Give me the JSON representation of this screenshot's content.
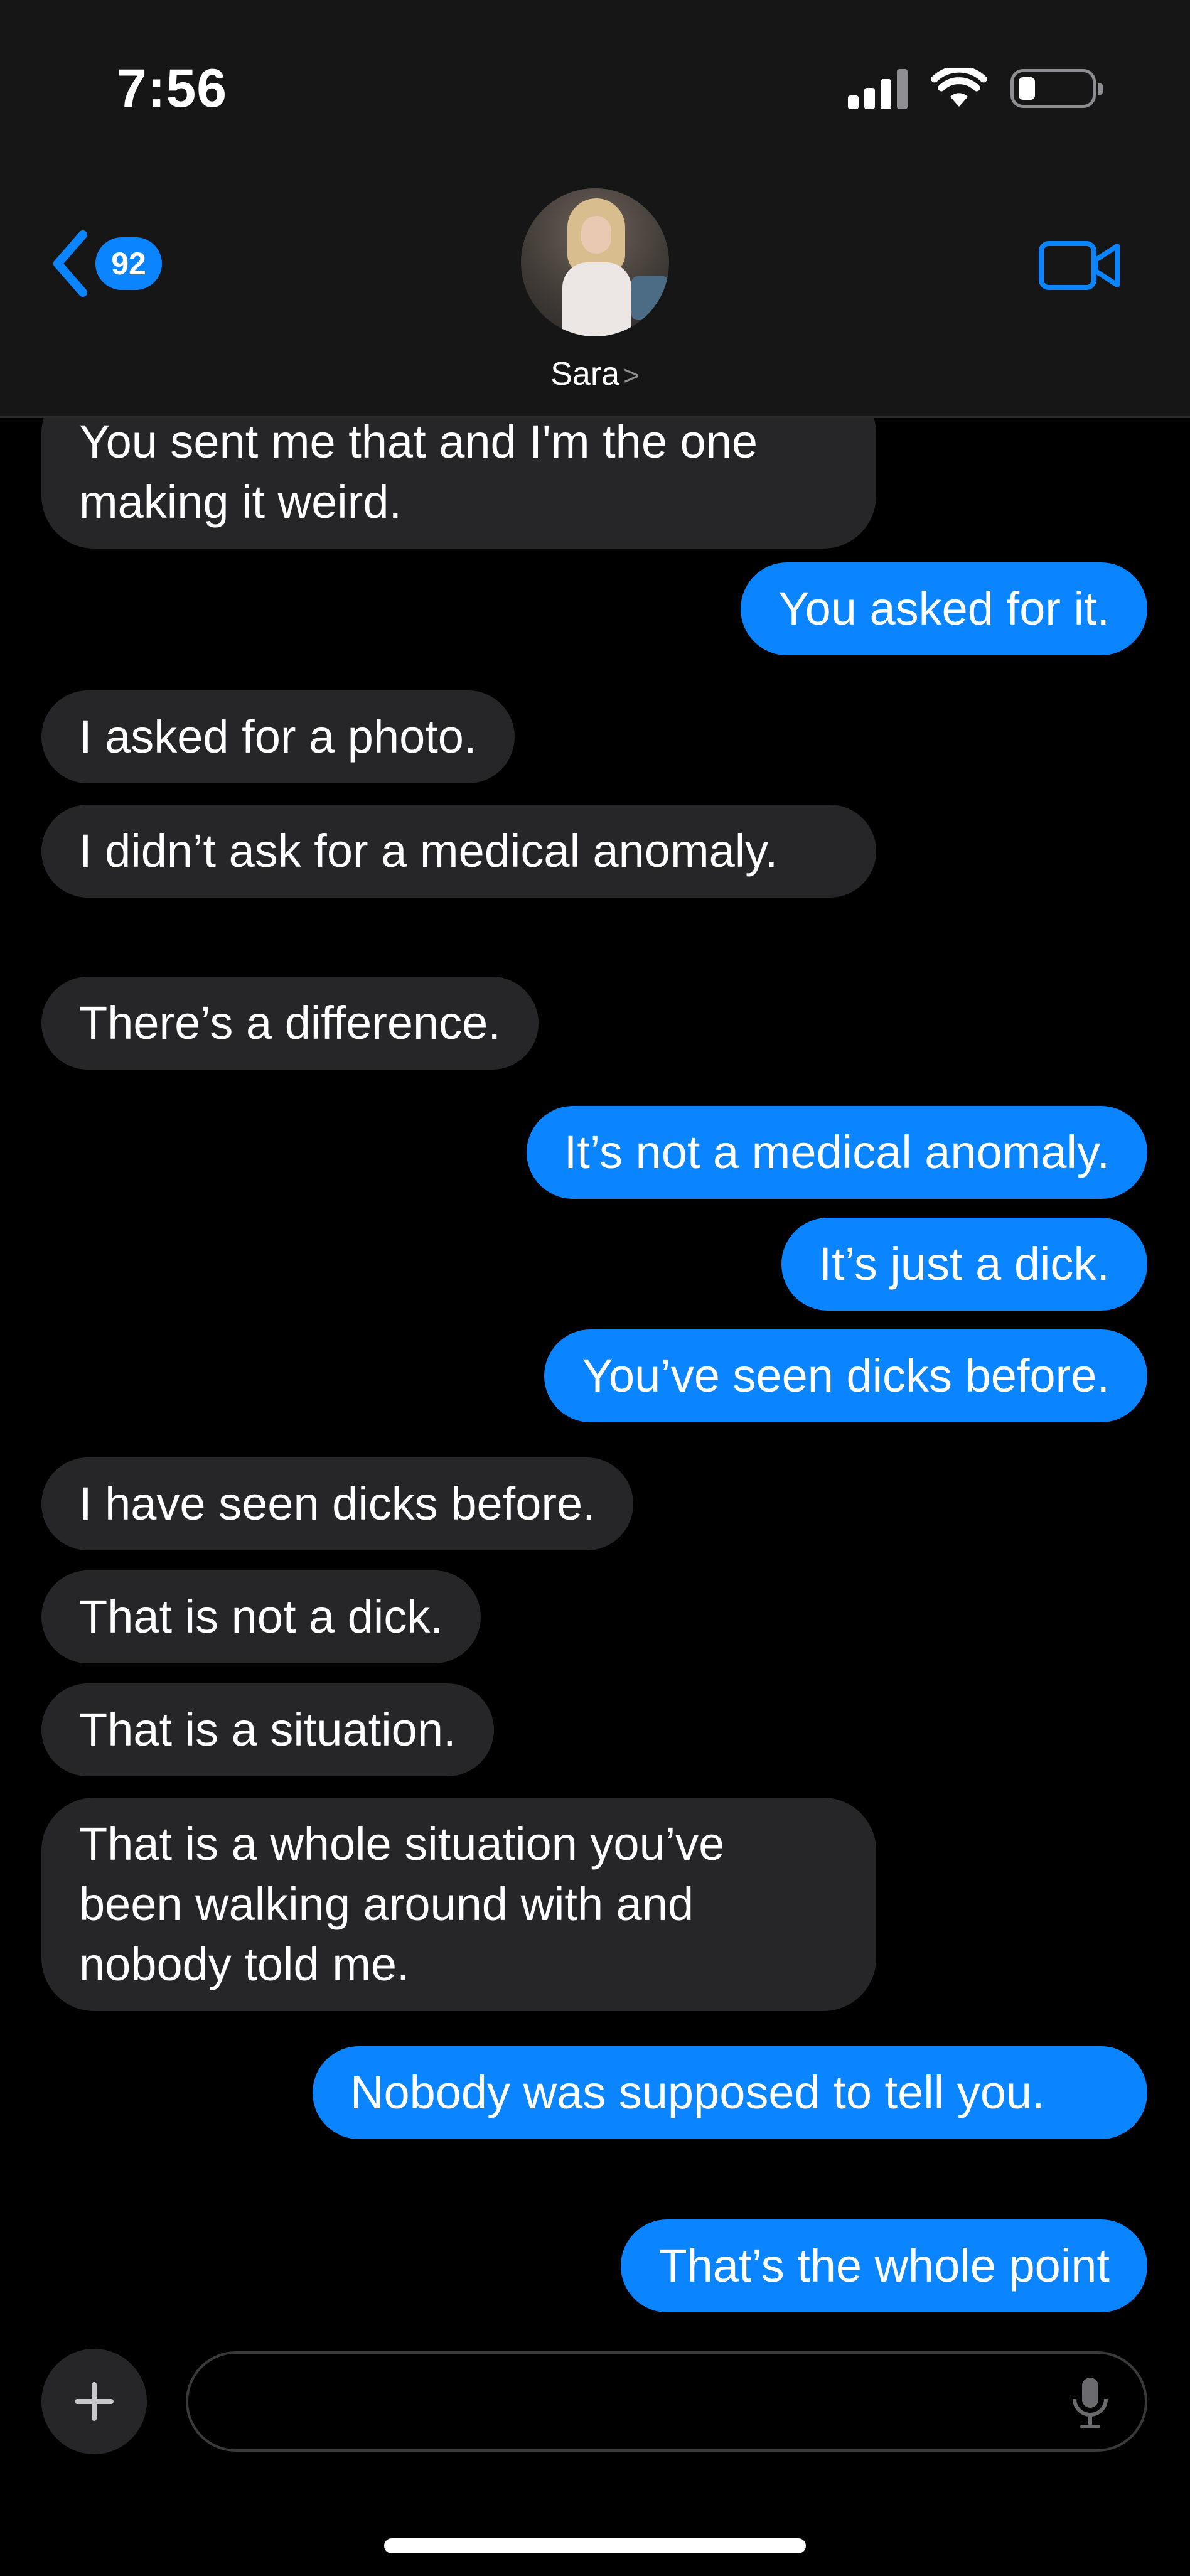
{
  "status_bar": {
    "time": "7:56"
  },
  "header": {
    "back_count": "92",
    "contact_name": "Sara",
    "contact_chevron": ">"
  },
  "messages": [
    {
      "sender": "them",
      "text": "You sent me that and I'm the one making it weird."
    },
    {
      "sender": "me",
      "text": "You asked for it."
    },
    {
      "sender": "them",
      "text": "I asked for a photo."
    },
    {
      "sender": "them",
      "text": "I didn’t ask for a medical anomaly."
    },
    {
      "sender": "them",
      "text": "There’s a difference."
    },
    {
      "sender": "me",
      "text": "It’s not a medical anomaly."
    },
    {
      "sender": "me",
      "text": "It’s just a dick."
    },
    {
      "sender": "me",
      "text": "You’ve seen dicks before."
    },
    {
      "sender": "them",
      "text": "I have seen dicks before."
    },
    {
      "sender": "them",
      "text": "That is not a dick."
    },
    {
      "sender": "them",
      "text": "That is a situation."
    },
    {
      "sender": "them",
      "text": "That is a whole situation you’ve been walking around with and nobody told me."
    },
    {
      "sender": "me",
      "text": "Nobody was supposed to tell you."
    },
    {
      "sender": "me",
      "text": "That’s the whole point"
    }
  ],
  "composer": {
    "value": "",
    "placeholder": ""
  },
  "icons": [
    "back-chevron-icon",
    "video-camera-icon",
    "plus-icon",
    "microphone-icon",
    "cellular-signal-icon",
    "wifi-icon",
    "battery-icon"
  ],
  "colors": {
    "outgoing": "#0a84ff",
    "incoming": "#262628",
    "background": "#000000",
    "header": "#161616"
  }
}
